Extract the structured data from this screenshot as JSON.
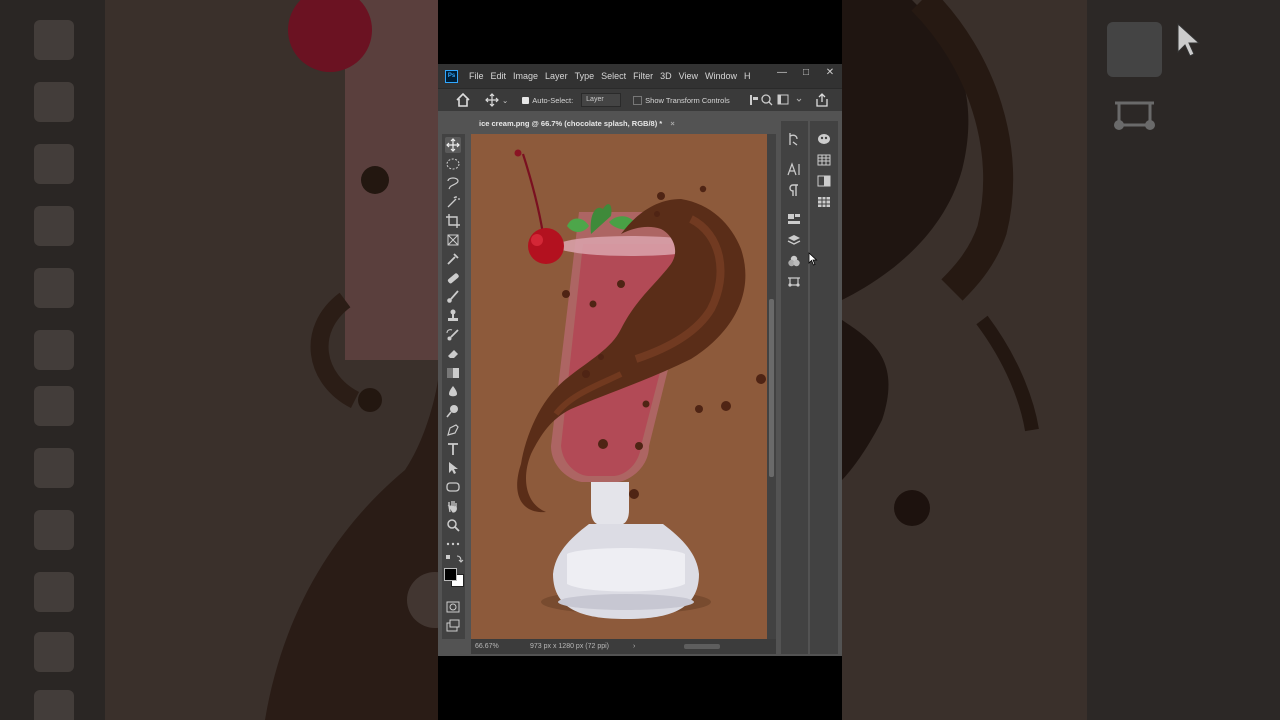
{
  "window": {
    "menu": [
      "File",
      "Edit",
      "Image",
      "Layer",
      "Type",
      "Select",
      "Filter",
      "3D",
      "View",
      "Window",
      "H"
    ],
    "controls": {
      "minimize": "—",
      "maximize": "□",
      "close": "✕"
    }
  },
  "options_bar": {
    "auto_select_label": "Auto-Select:",
    "auto_select_value": "Layer",
    "transform_label": "Show Transform Controls"
  },
  "document_tab": {
    "title": "ice cream.png @ 66.7% (chocolate splash, RGB/8) *",
    "close": "×"
  },
  "status_bar": {
    "zoom": "66.67%",
    "doc_info": "973 px x 1280 px (72 ppi)",
    "arrow": "›"
  },
  "tools": [
    "move",
    "marquee",
    "lasso",
    "magic-wand",
    "crop",
    "frame",
    "eyedropper",
    "healing",
    "brush",
    "stamp",
    "history-brush",
    "eraser",
    "gradient",
    "blur",
    "dodge",
    "pen",
    "type",
    "path-select",
    "shape",
    "hand",
    "zoom",
    "more",
    "swap-colors",
    "foreground-background",
    "quick-mask",
    "screen-mode"
  ],
  "panel_icons_left": [
    "history",
    "character",
    "paragraph",
    "libraries",
    "layers",
    "channels",
    "paths"
  ],
  "panel_icons_right": [
    "color",
    "swatches",
    "gradients",
    "patterns"
  ],
  "colors": {
    "canvas_bg": "#8d5a3b",
    "foreground": "#000000",
    "background": "#ffffff",
    "accent": "#31a8ff"
  }
}
